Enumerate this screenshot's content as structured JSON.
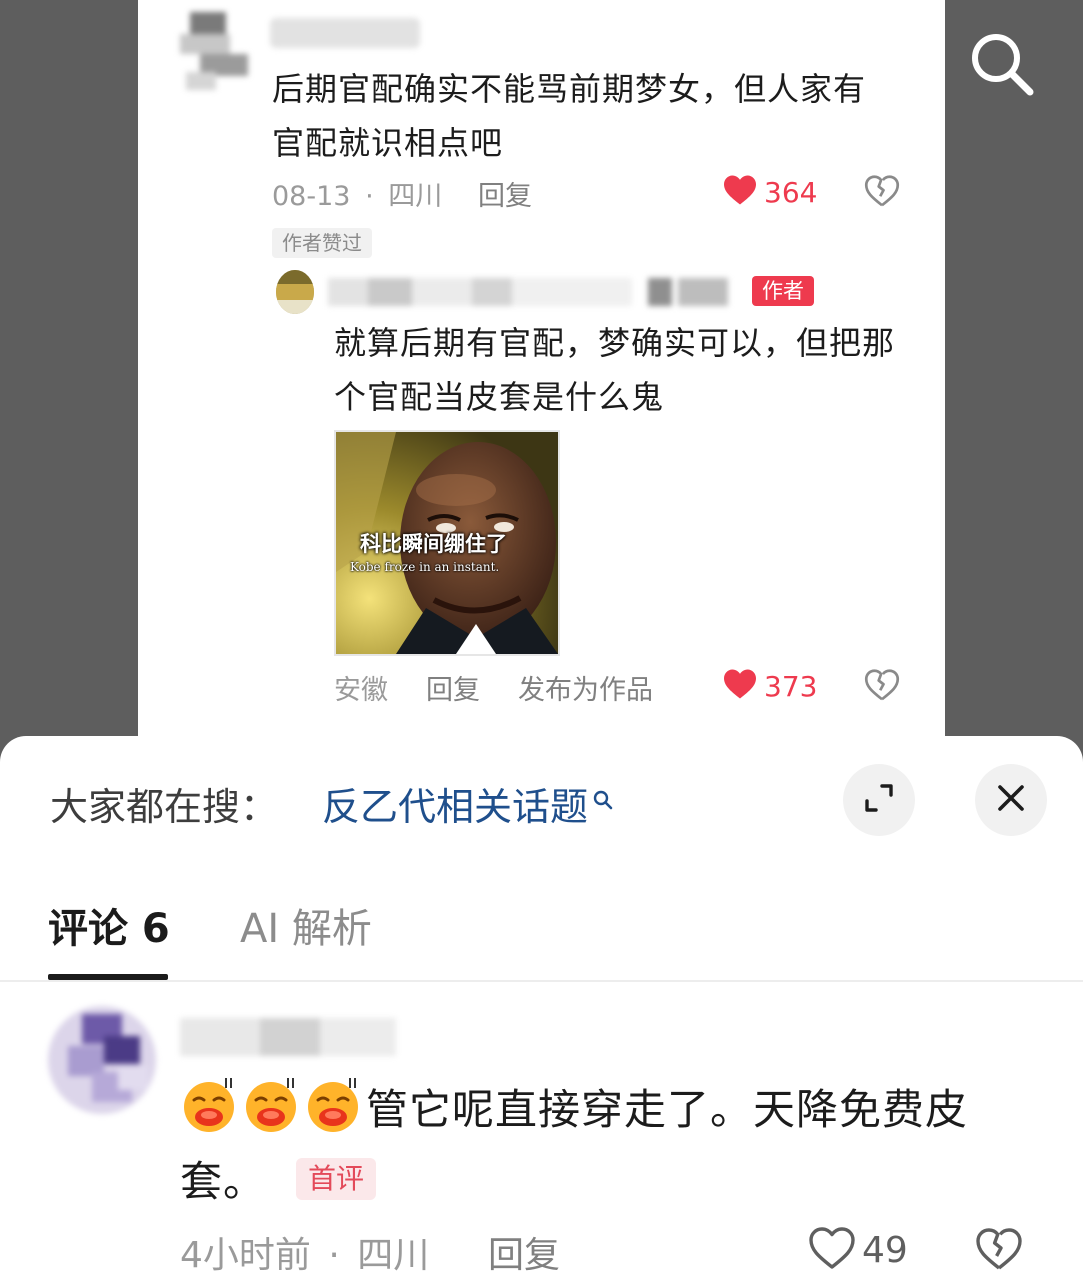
{
  "colors": {
    "accent_red": "#ee3a4e",
    "link_blue": "#1f4f8c",
    "muted_text": "#9a9a9a"
  },
  "background": {
    "top_comment": {
      "text": "后期官配确实不能骂前期梦女，但人家有官配就识相点吧",
      "date": "08-13",
      "separator": "·",
      "location": "四川",
      "reply_label": "回复",
      "likes": "364",
      "author_liked_badge": "作者赞过"
    },
    "author_reply": {
      "author_badge": "作者",
      "text": "就算后期有官配，梦确实可以，但把那个官配当皮套是什么鬼",
      "image_caption_cn": "科比瞬间绷住了",
      "image_caption_en": "Kobe froze in an instant.",
      "location": "安徽",
      "reply_label": "回复",
      "publish_label": "发布为作品",
      "likes": "373"
    },
    "search_icon": "search-icon"
  },
  "sheet": {
    "hot_search_prefix": "大家都在搜：",
    "hot_search_link": "反乙代相关话题",
    "expand_icon": "expand-icon",
    "close_icon": "close-icon",
    "tabs": [
      {
        "label": "评论 6",
        "active": true
      },
      {
        "label": "AI 解析",
        "active": false
      }
    ],
    "comment": {
      "emoji_icons": [
        "tongue-emoji",
        "tongue-emoji",
        "tongue-emoji"
      ],
      "text": "管它呢直接穿走了。天降免费皮套。",
      "first_badge": "首评",
      "time": "4小时前",
      "separator": "·",
      "location": "四川",
      "reply_label": "回复",
      "likes": "49"
    }
  }
}
